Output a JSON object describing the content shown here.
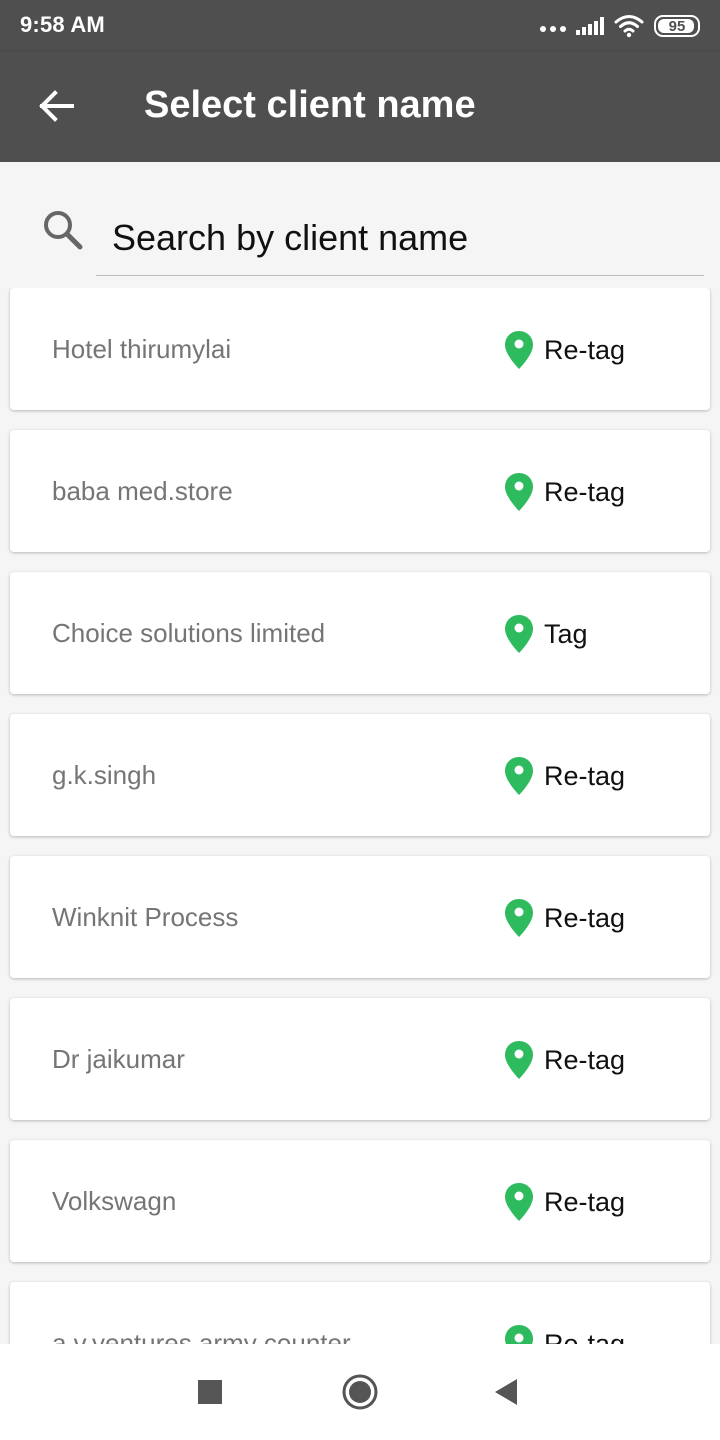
{
  "status_bar": {
    "time": "9:58 AM",
    "battery_level": "95",
    "icons": [
      "more-dots-icon",
      "signal-icon",
      "wifi-icon",
      "battery-icon"
    ]
  },
  "app_bar": {
    "back_icon": "back-arrow-icon",
    "title": "Select client name",
    "background_color": "#4f4f4f"
  },
  "search": {
    "icon": "search-icon",
    "placeholder": "Search by client name",
    "value": ""
  },
  "accent_color": "#2dbb5d",
  "clients": [
    {
      "name": "Hotel thirumylai",
      "action": "Re-tag",
      "icon": "location-pin-icon"
    },
    {
      "name": "baba med.store",
      "action": "Re-tag",
      "icon": "location-pin-icon"
    },
    {
      "name": "Choice solutions limited",
      "action": "Tag",
      "icon": "location-pin-icon"
    },
    {
      "name": "g.k.singh",
      "action": "Re-tag",
      "icon": "location-pin-icon"
    },
    {
      "name": "Winknit Process",
      "action": "Re-tag",
      "icon": "location-pin-icon"
    },
    {
      "name": "Dr jaikumar",
      "action": "Re-tag",
      "icon": "location-pin-icon"
    },
    {
      "name": "Volkswagn",
      "action": "Re-tag",
      "icon": "location-pin-icon"
    },
    {
      "name": "a.v.ventures army counter",
      "action": "Re-tag",
      "icon": "location-pin-icon"
    }
  ],
  "nav_bar": {
    "icons": [
      "recents-square-icon",
      "home-circle-icon",
      "back-triangle-icon"
    ]
  }
}
